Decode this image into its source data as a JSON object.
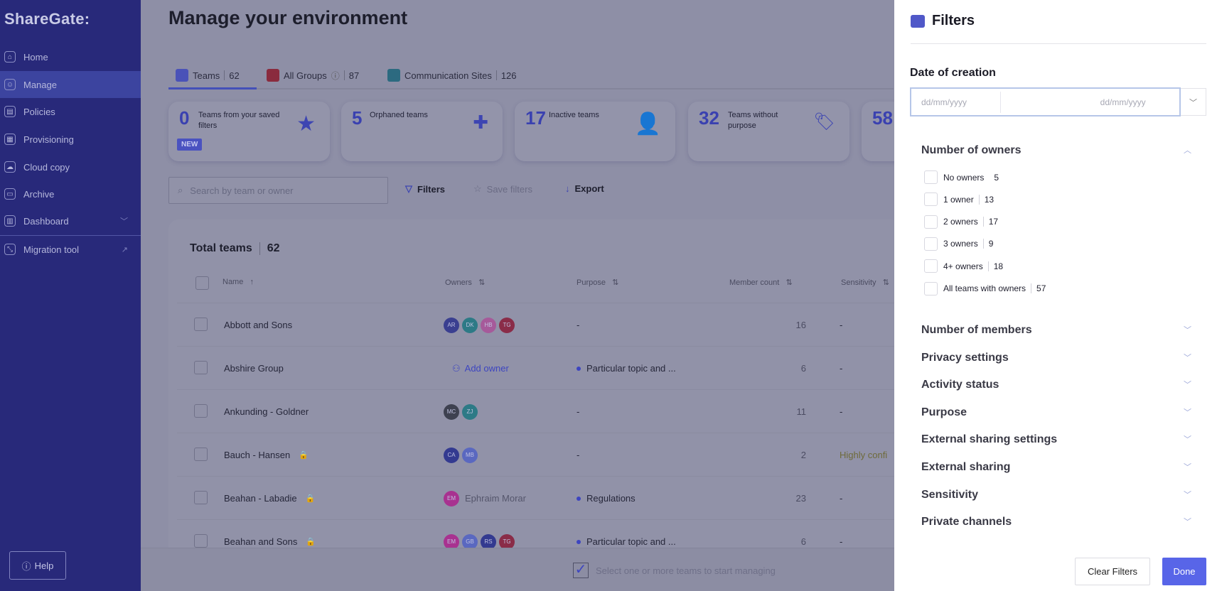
{
  "sidebar": {
    "logo": "ShareGate:",
    "items": [
      {
        "label": "Home",
        "icon": "home-icon"
      },
      {
        "label": "Manage",
        "icon": "manage-icon",
        "active": true
      },
      {
        "label": "Policies",
        "icon": "policy-icon"
      },
      {
        "label": "Provisioning",
        "icon": "provisioning-icon"
      },
      {
        "label": "Cloud copy",
        "icon": "cloud-icon"
      },
      {
        "label": "Archive",
        "icon": "archive-icon"
      },
      {
        "label": "Dashboard",
        "icon": "dashboard-icon"
      }
    ],
    "migration": "Migration tool",
    "help": "Help"
  },
  "main": {
    "title": "Manage your environment",
    "tabs": [
      {
        "label": "Teams",
        "count": "62"
      },
      {
        "label": "All Groups",
        "count": "87"
      },
      {
        "label": "Communication Sites",
        "count": "126"
      }
    ],
    "cards": [
      {
        "num": "0",
        "label": "Teams from your saved filters",
        "badge": "NEW",
        "icon": "star-icon"
      },
      {
        "num": "5",
        "label": "Orphaned teams",
        "icon": "add-owner-icon"
      },
      {
        "num": "17",
        "label": "Inactive teams",
        "icon": "sleeping-user-icon"
      },
      {
        "num": "32",
        "label": "Teams without purpose",
        "icon": "tag-icon"
      },
      {
        "num": "58"
      }
    ],
    "search_placeholder": "Search by team or owner",
    "filters": "Filters",
    "save_filters": "Save filters",
    "export": "Export",
    "total_label": "Total teams",
    "total": "62",
    "columns": [
      "Name",
      "Owners",
      "Purpose",
      "Member count",
      "Sensitivity"
    ],
    "rows": [
      {
        "name": "Abbott and Sons",
        "owners": [
          "AR",
          "DK",
          "HB",
          "TG"
        ],
        "purpose": "-",
        "members": "16",
        "sensitivity": "-"
      },
      {
        "name": "Abshire Group",
        "owners": [],
        "add_owner": "Add owner",
        "purpose": "Particular topic and ...",
        "members": "6",
        "sensitivity": "-"
      },
      {
        "name": "Ankunding - Goldner",
        "owners": [
          "MC",
          "ZJ"
        ],
        "purpose": "-",
        "members": "11",
        "sensitivity": "-"
      },
      {
        "name": "Bauch - Hansen",
        "lock": true,
        "owners": [
          "CA",
          "MB"
        ],
        "purpose": "-",
        "members": "2",
        "sensitivity": "Highly confi"
      },
      {
        "name": "Beahan - Labadie",
        "lock": true,
        "owners": [
          "EM"
        ],
        "owner_name": "Ephraim Morar",
        "purpose": "Regulations",
        "members": "23",
        "sensitivity": "-"
      },
      {
        "name": "Beahan and Sons",
        "lock": true,
        "owners": [
          "EM",
          "GB",
          "RS",
          "TG"
        ],
        "purpose": "Particular topic and ...",
        "members": "6",
        "sensitivity": "-"
      }
    ],
    "select_hint": "Select one or more teams to start managing"
  },
  "panel": {
    "title": "Filters",
    "date_label": "Date of creation",
    "date_from_placeholder": "dd/mm/yyyy",
    "date_to_placeholder": "dd/mm/yyyy",
    "owners_section": "Number of owners",
    "owner_options": [
      {
        "label": "No owners",
        "count": "5"
      },
      {
        "label": "1 owner",
        "count": "13"
      },
      {
        "label": "2 owners",
        "count": "17"
      },
      {
        "label": "3 owners",
        "count": "9"
      },
      {
        "label": "4+ owners",
        "count": "18"
      },
      {
        "label": "All teams with owners",
        "count": "57"
      }
    ],
    "sections": [
      "Number of members",
      "Privacy settings",
      "Activity status",
      "Purpose",
      "External sharing settings",
      "External sharing",
      "Sensitivity",
      "Private channels"
    ],
    "clear": "Clear Filters",
    "done": "Done"
  },
  "colors": {
    "sidebar": "#28297a",
    "accent": "#5865e8",
    "overlay": "#8e8fa6"
  }
}
